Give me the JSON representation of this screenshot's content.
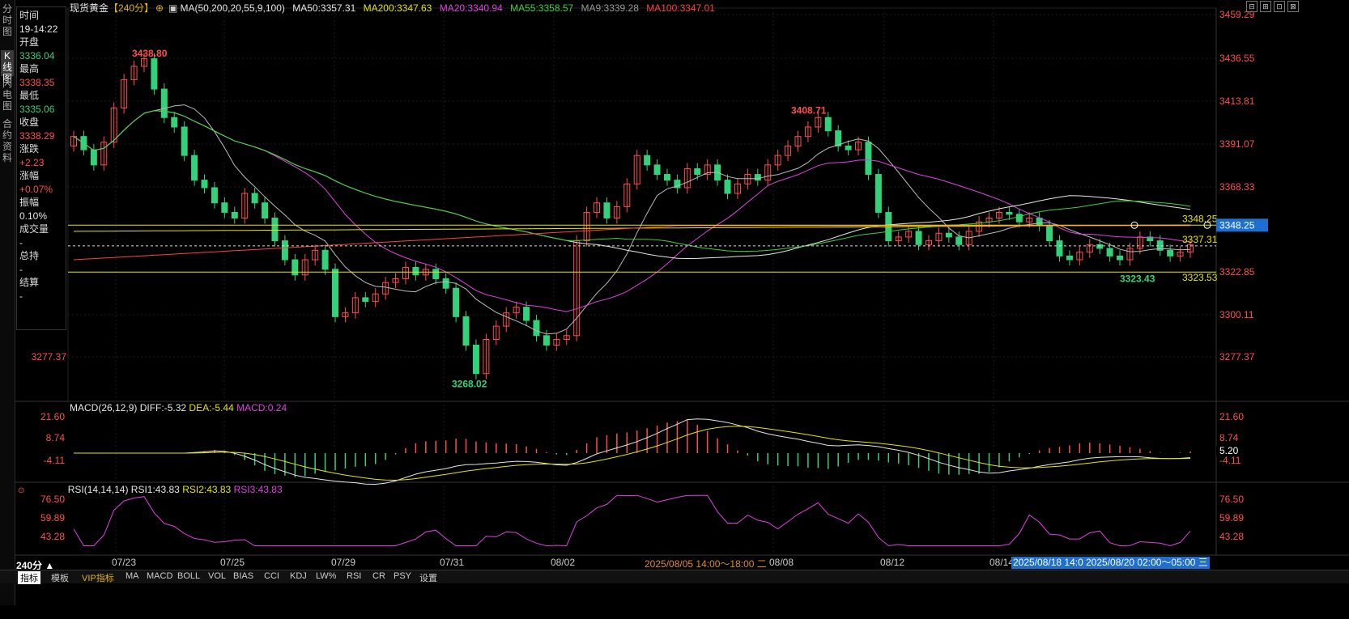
{
  "instrument": "现货黄金",
  "period_bracket": "【240分】",
  "sidebar_tabs": [
    "分时图",
    "K线图",
    "闪电图",
    "合约资料"
  ],
  "info_panel": {
    "time_label": "时间",
    "time_value": "19-14:22",
    "open_label": "开盘",
    "open_value": "3336.04",
    "high_label": "最高",
    "high_value": "3338.35",
    "low_label": "最低",
    "low_value": "3335.06",
    "close_label": "收盘",
    "close_value": "3338.29",
    "change_label": "涨跌",
    "change_value": "+2.23",
    "change_pct_label": "涨幅",
    "change_pct_value": "+0.07%",
    "amplitude_label": "振幅",
    "amplitude_value": "0.10%",
    "volume_label": "成交量",
    "volume_value": "-",
    "oi_label": "总持",
    "oi_value": "-",
    "settle_label": "结算",
    "settle_value": "-"
  },
  "ma_legend": {
    "params": "MA(50,200,20,55,9,100)",
    "ma50": "MA50:3357.31",
    "ma200": "MA200:3347.63",
    "ma20": "MA20:3340.94",
    "ma55": "MA55:3358.57",
    "ma9": "MA9:3339.28",
    "ma100": "MA100:3347.01"
  },
  "colors": {
    "up": "#ff4d4d",
    "down": "#33d17a",
    "ma50": "#e6e6e6",
    "ma200": "#e6e600",
    "ma20": "#e040e0",
    "ma55": "#3ad13a",
    "ma9": "#bbbbbb",
    "ma100": "#ff4040",
    "axis_red": "#ff4d4d",
    "accent_blue": "#1e6fd0"
  },
  "price_axis_labels": [
    "3459.29",
    "3436.55",
    "3413.81",
    "3391.07",
    "3368.33",
    "3322.85",
    "3300.11",
    "3277.37"
  ],
  "left_axis_labels": [
    "3300.11",
    "3277.37"
  ],
  "annotations": {
    "high_1": "3438.80",
    "high_2": "3408.71",
    "low_1": "3268.02",
    "low_2": "3323.43",
    "line_1": "3348.25",
    "line_2": "3337.31",
    "line_3": "3323.53",
    "current_price": "3348.25"
  },
  "macd_legend": {
    "params": "MACD(26,12,9)",
    "diff": "DIFF:-5.32",
    "dea": "DEA:-5.44",
    "macd": "MACD:0.24"
  },
  "macd_axis_labels": [
    "21.60",
    "8.74",
    "-4.11"
  ],
  "macd_marker": "5.20",
  "rsi_legend": {
    "params": "RSI(14,14,14)",
    "rsi1": "RSI1:43.83",
    "rsi2": "RSI2:43.83",
    "rsi3": "RSI3:43.83"
  },
  "rsi_axis_labels": [
    "76.50",
    "59.89",
    "43.28"
  ],
  "date_labels": [
    "07/23",
    "07/25",
    "07/29",
    "07/31",
    "08/02",
    "08/08",
    "08/12",
    "08/14"
  ],
  "date_tooltips": [
    "2025/08/05 14:00～18:00 二",
    "2025/08/18 14:0",
    "2025/08/20 02:00～05:00 三"
  ],
  "period_label": "240分 ▲",
  "bottom_tabs": [
    "指标",
    "模板",
    "VIP指标",
    "MA",
    "MACD",
    "BOLL",
    "VOL",
    "BIAS",
    "CCI",
    "KDJ",
    "LW%",
    "RSI",
    "CR",
    "PSY",
    "设置"
  ],
  "top_icons": [
    "restore-icon",
    "maximize-icon",
    "fullscreen-icon",
    "close-window-icon"
  ],
  "top_icon_glyphs": [
    "⊟",
    "⊞",
    "⊡",
    "⊠"
  ]
}
